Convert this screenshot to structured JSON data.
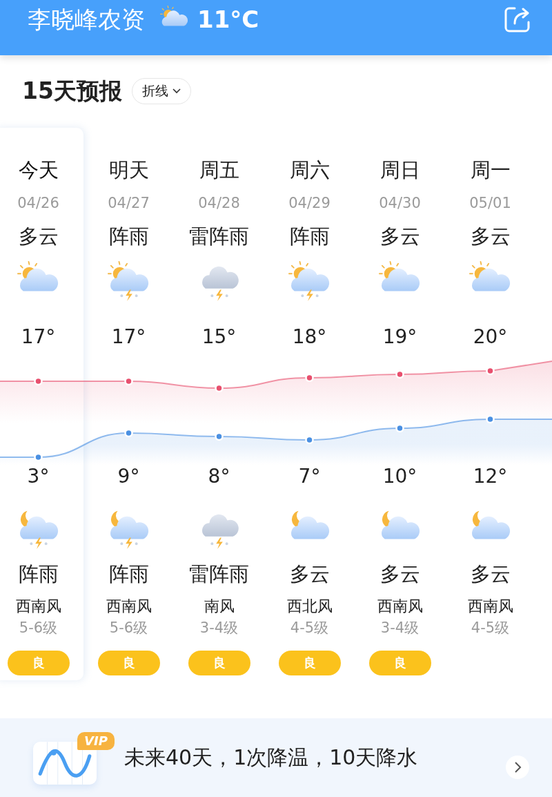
{
  "header": {
    "title": "李晓峰农资",
    "weather_icon": {
      "kind": "sun_cloud"
    },
    "temperature": "11°C"
  },
  "forecast": {
    "title": "15天预报",
    "mode_toggle": "折线",
    "days": [
      {
        "day": "今天",
        "date": "04/26",
        "day_weather": "多云",
        "day_icon": {
          "kind": "sun_cloud"
        },
        "high": "17°",
        "low": "3°",
        "night_icon": {
          "kind": "moon_shower"
        },
        "night_weather": "阵雨",
        "wind": "西南风",
        "wind_level": "5-6级",
        "aqi": "良",
        "selected": true
      },
      {
        "day": "明天",
        "date": "04/27",
        "day_weather": "阵雨",
        "day_icon": {
          "kind": "sun_shower"
        },
        "high": "17°",
        "low": "9°",
        "night_icon": {
          "kind": "moon_shower"
        },
        "night_weather": "阵雨",
        "wind": "西南风",
        "wind_level": "5-6级",
        "aqi": "良",
        "selected": false
      },
      {
        "day": "周五",
        "date": "04/28",
        "day_weather": "雷阵雨",
        "day_icon": {
          "kind": "thunder"
        },
        "high": "15°",
        "low": "8°",
        "night_icon": {
          "kind": "thunder"
        },
        "night_weather": "雷阵雨",
        "wind": "南风",
        "wind_level": "3-4级",
        "aqi": "良",
        "selected": false
      },
      {
        "day": "周六",
        "date": "04/29",
        "day_weather": "阵雨",
        "day_icon": {
          "kind": "sun_shower"
        },
        "high": "18°",
        "low": "7°",
        "night_icon": {
          "kind": "moon_cloud"
        },
        "night_weather": "多云",
        "wind": "西北风",
        "wind_level": "4-5级",
        "aqi": "良",
        "selected": false
      },
      {
        "day": "周日",
        "date": "04/30",
        "day_weather": "多云",
        "day_icon": {
          "kind": "sun_cloud"
        },
        "high": "19°",
        "low": "10°",
        "night_icon": {
          "kind": "moon_cloud"
        },
        "night_weather": "多云",
        "wind": "西南风",
        "wind_level": "3-4级",
        "aqi": "良",
        "selected": false
      },
      {
        "day": "周一",
        "date": "05/01",
        "day_weather": "多云",
        "day_icon": {
          "kind": "sun_cloud"
        },
        "high": "20°",
        "low": "12°",
        "night_icon": {
          "kind": "moon_cloud"
        },
        "night_weather": "多云",
        "wind": "西南风",
        "wind_level": "4-5级",
        "selected": false
      }
    ]
  },
  "banner": {
    "badge": "VIP",
    "text": "未来40天，1次降温，10天降水"
  }
}
